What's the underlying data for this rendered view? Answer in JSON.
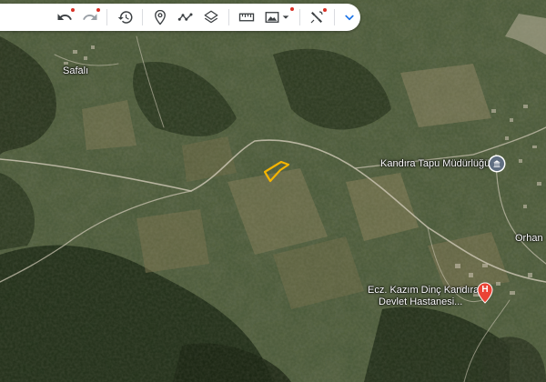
{
  "toolbar": {
    "buttons": [
      {
        "icon": "undo-icon"
      },
      {
        "icon": "redo-icon"
      },
      {
        "icon": "history-icon"
      },
      {
        "icon": "placemark-icon"
      },
      {
        "icon": "path-icon"
      },
      {
        "icon": "layers-icon"
      },
      {
        "icon": "ruler-icon"
      },
      {
        "icon": "image-overlay-icon"
      },
      {
        "icon": "satellite-tools-icon"
      },
      {
        "icon": "chevron-down-icon"
      }
    ],
    "colors": {
      "accent": "#1a73e8",
      "badge": "#d93025",
      "icon": "#3c4043"
    }
  },
  "map": {
    "labels": {
      "safali": "Safalı",
      "tapu": "Kandıra Tapu Müdürlüğü",
      "orhan": "Orhan",
      "hospital_line1": "Ecz. Kazım Dinç Kandıra",
      "hospital_line2": "Devlet Hastanesi..."
    },
    "hospital_glyph": "H",
    "colors": {
      "selection": "#f4b400",
      "hospital": "#ea4335",
      "government": "#5f6e81"
    }
  }
}
